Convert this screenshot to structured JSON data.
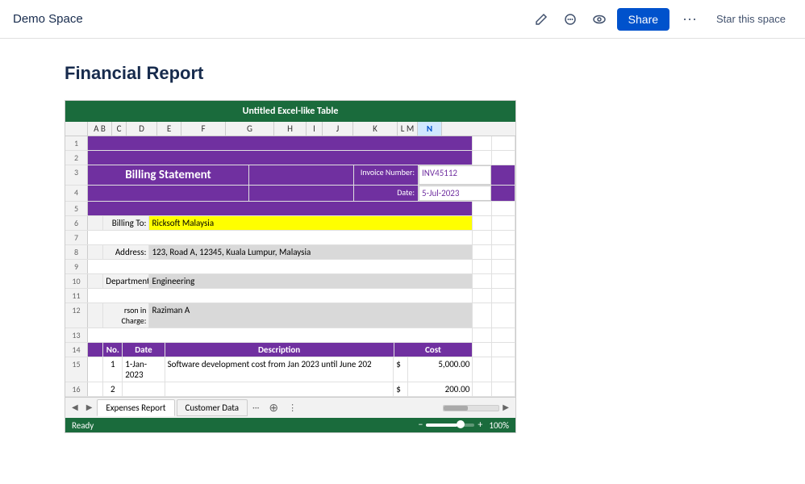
{
  "topbar": {
    "title": "Demo Space",
    "share_label": "Share",
    "star_label": "Star this space"
  },
  "page": {
    "title": "Financial Report"
  },
  "excel": {
    "header": "Untitled Excel-like Table",
    "columns": [
      "A B",
      "C",
      "D",
      "E",
      "F",
      "G",
      "H",
      "I",
      "J",
      "K",
      "L M",
      "N"
    ],
    "billing_statement": "Billing Statement",
    "invoice_label": "Invoice Number:",
    "invoice_value": "INV45112",
    "date_label": "Date:",
    "date_value": "5-Jul-2023",
    "billing_to_label": "Billing To:",
    "billing_to_value": "Ricksoft Malaysia",
    "address_label": "Address:",
    "address_value": "123, Road A, 12345, Kuala Lumpur, Malaysia",
    "department_label": "Department:",
    "department_value": "Engineering",
    "person_label": "rson in Charge:",
    "person_value": "Raziman A",
    "table_cols": [
      "No.",
      "Date",
      "Description",
      "Cost"
    ],
    "row1_no": "1",
    "row1_date": "1-Jan-2023",
    "row1_desc": "Software development cost from Jan 2023 until June 202",
    "row1_cost": "5,000.00",
    "row2_no": "2",
    "row2_cost": "200.00",
    "tab1": "Expenses Report",
    "tab2": "Customer Data",
    "status": "Ready",
    "zoom": "100%"
  }
}
